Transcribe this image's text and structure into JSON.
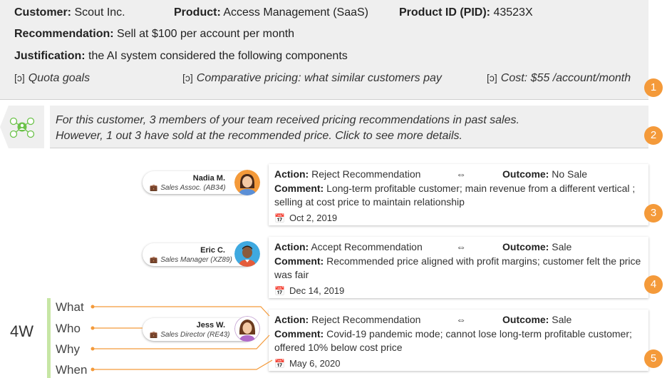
{
  "header": {
    "customer_label": "Customer:",
    "customer_value": "Scout Inc.",
    "product_label": "Product:",
    "product_value": "Access Management (SaaS)",
    "pid_label": "Product ID (PID):",
    "pid_value": "43523X",
    "recommendation_label": "Recommendation:",
    "recommendation_value": "Sell at $100 per account per month",
    "justification_label": "Justification:",
    "justification_value": "the AI system considered the following components",
    "components": [
      {
        "mark": "[ɔ]",
        "text": "Quota goals"
      },
      {
        "mark": "[ɔ]",
        "text": "Comparative pricing: what similar customers pay"
      },
      {
        "mark": "[ɔ]",
        "text": "Cost: $55 /account/month"
      }
    ]
  },
  "insight": {
    "line1": "For this customer, 3 members of your team received pricing recommendations in past sales.",
    "line2": "However, 1 out 3 have sold at the recommended price. Click to see more details."
  },
  "badges": [
    "1",
    "2",
    "3",
    "4",
    "5"
  ],
  "records": [
    {
      "name": "Nadia M.",
      "role": "Sales Assoc.  (AB34)",
      "action_label": "Action:",
      "action": "Reject Recommendation",
      "arrow": "⇔",
      "outcome_label": "Outcome:",
      "outcome": "No Sale",
      "comment_label": "Comment:",
      "comment": "Long-term profitable customer; main revenue from a different vertical ; selling at cost price to maintain relationship",
      "date": "Oct 2, 2019"
    },
    {
      "name": "Eric C.",
      "role": "Sales Manager (XZ89)",
      "action_label": "Action:",
      "action": "Accept Recommendation",
      "arrow": "⇔",
      "outcome_label": "Outcome:",
      "outcome": "Sale",
      "comment_label": "Comment:",
      "comment": "Recommended price aligned with profit margins; customer felt the price was fair",
      "date": "Dec 14, 2019"
    },
    {
      "name": "Jess W.",
      "role": "Sales Director (RE43)",
      "action_label": "Action:",
      "action": "Reject Recommendation",
      "arrow": "⇔",
      "outcome_label": "Outcome:",
      "outcome": "Sale",
      "comment_label": "Comment:",
      "comment": "Covid-19 pandemic mode; cannot lose long-term profitable customer; offered 10% below cost price",
      "date": "May 6, 2020"
    }
  ],
  "legend": {
    "title": "4W",
    "items": [
      "What",
      "Who",
      "Why",
      "When"
    ]
  },
  "colors": {
    "badge": "#f49a3a",
    "connector": "#f49a3a",
    "network_icon": "#6cc24a",
    "legend_bar": "#c7e6a5"
  },
  "icons": {
    "component_marker": "bracket-marker-icon",
    "role": "briefcase-icon",
    "date": "calendar-icon",
    "insight": "team-network-icon"
  }
}
